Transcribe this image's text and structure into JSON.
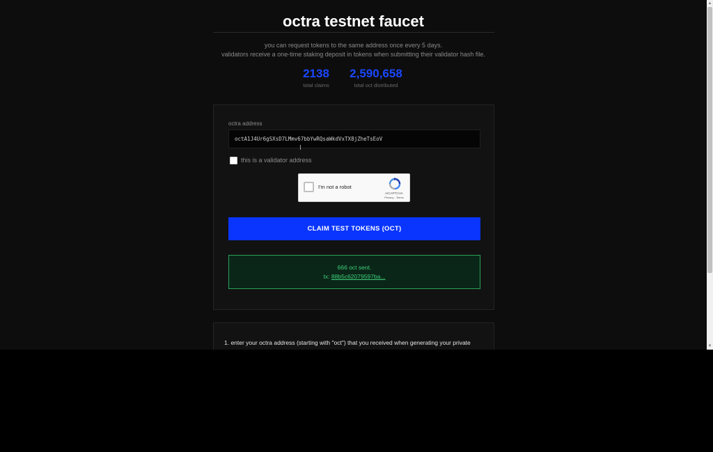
{
  "header": {
    "title": "octra testnet faucet",
    "description_line1": "you can request tokens to the same address once every 5 days.",
    "description_line2": "validators receive a one-time staking deposit in tokens when submitting their validator hash file."
  },
  "stats": [
    {
      "value": "2138",
      "label": "total claims"
    },
    {
      "value": "2,590,658",
      "label": "total oct distributed"
    }
  ],
  "form": {
    "address_label": "octra address",
    "address_value": "octA1J4Ur6gSXsD7LMmv67bbYwRQsaWkdVxTX8jZheTsEoV",
    "validator_label": "this is a validator address",
    "validator_checked": false,
    "recaptcha": {
      "label": "I'm not a robot",
      "brand": "reCAPTCHA",
      "links": "Privacy - Terms"
    },
    "claim_button_label": "CLAIM TEST TOKENS (OCT)"
  },
  "result": {
    "message": "666 oct sent.",
    "tx_prefix": "tx:",
    "tx_hash": "88b5c62079597ba..."
  },
  "instructions": {
    "step1": "1. enter your octra address (starting with \"oct\") that you received when generating your private"
  },
  "colors": {
    "accent_blue": "#0a35ff",
    "stat_blue": "#1a47ff",
    "success_green": "#3fcf7a",
    "background": "#0d0d0d"
  },
  "icons": {
    "recaptcha_logo": "recaptcha-logo-icon",
    "text_cursor": "text-cursor-icon"
  }
}
